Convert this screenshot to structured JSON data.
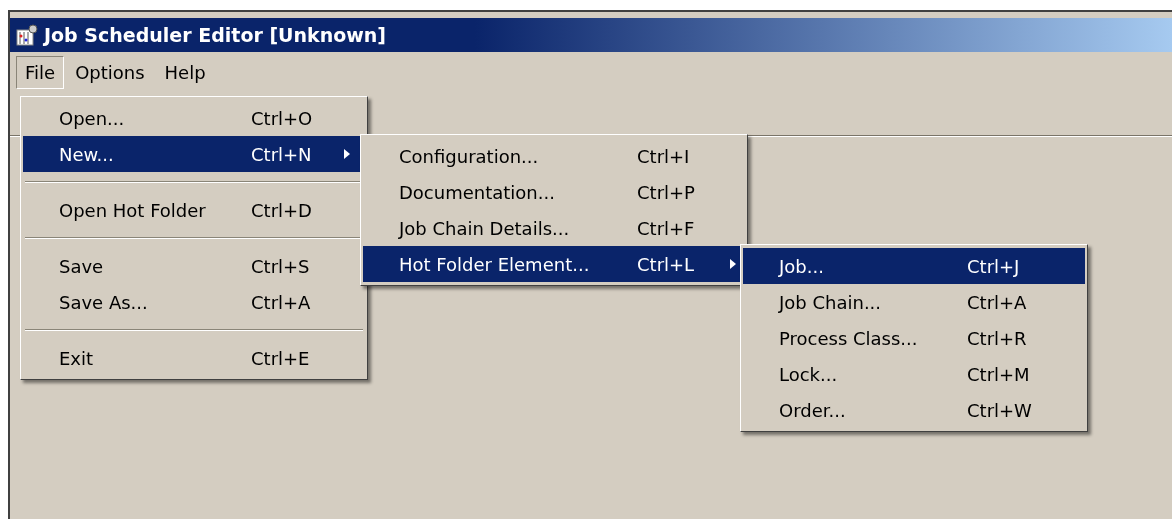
{
  "window": {
    "title": "Job Scheduler Editor [Unknown]"
  },
  "menubar": [
    {
      "label": "File",
      "selected": true
    },
    {
      "label": "Options",
      "selected": false
    },
    {
      "label": "Help",
      "selected": false
    }
  ],
  "menus": [
    {
      "items": [
        {
          "kind": "item",
          "label": "Open...",
          "shortcut": "Ctrl+O",
          "selected": false,
          "has_submenu": false
        },
        {
          "kind": "item",
          "label": "New...",
          "shortcut": "Ctrl+N",
          "selected": true,
          "has_submenu": true
        },
        {
          "kind": "separator"
        },
        {
          "kind": "item",
          "label": "Open Hot Folder",
          "shortcut": "Ctrl+D",
          "selected": false,
          "has_submenu": false
        },
        {
          "kind": "separator"
        },
        {
          "kind": "item",
          "label": "Save",
          "shortcut": "Ctrl+S",
          "selected": false,
          "has_submenu": false
        },
        {
          "kind": "item",
          "label": "Save As...",
          "shortcut": "Ctrl+A",
          "selected": false,
          "has_submenu": false
        },
        {
          "kind": "separator"
        },
        {
          "kind": "item",
          "label": "Exit",
          "shortcut": "Ctrl+E",
          "selected": false,
          "has_submenu": false
        }
      ]
    },
    {
      "items": [
        {
          "kind": "item",
          "label": "Configuration...",
          "shortcut": "Ctrl+I",
          "selected": false,
          "has_submenu": false
        },
        {
          "kind": "item",
          "label": "Documentation...",
          "shortcut": "Ctrl+P",
          "selected": false,
          "has_submenu": false
        },
        {
          "kind": "item",
          "label": "Job Chain Details...",
          "shortcut": "Ctrl+F",
          "selected": false,
          "has_submenu": false
        },
        {
          "kind": "item",
          "label": "Hot Folder Element...",
          "shortcut": "Ctrl+L",
          "selected": true,
          "has_submenu": true
        }
      ]
    },
    {
      "items": [
        {
          "kind": "item",
          "label": "Job...",
          "shortcut": "Ctrl+J",
          "selected": true,
          "has_submenu": false
        },
        {
          "kind": "item",
          "label": "Job Chain...",
          "shortcut": "Ctrl+A",
          "selected": false,
          "has_submenu": false
        },
        {
          "kind": "item",
          "label": "Process Class...",
          "shortcut": "Ctrl+R",
          "selected": false,
          "has_submenu": false
        },
        {
          "kind": "item",
          "label": "Lock...",
          "shortcut": "Ctrl+M",
          "selected": false,
          "has_submenu": false
        },
        {
          "kind": "item",
          "label": "Order...",
          "shortcut": "Ctrl+W",
          "selected": false,
          "has_submenu": false
        }
      ]
    }
  ]
}
